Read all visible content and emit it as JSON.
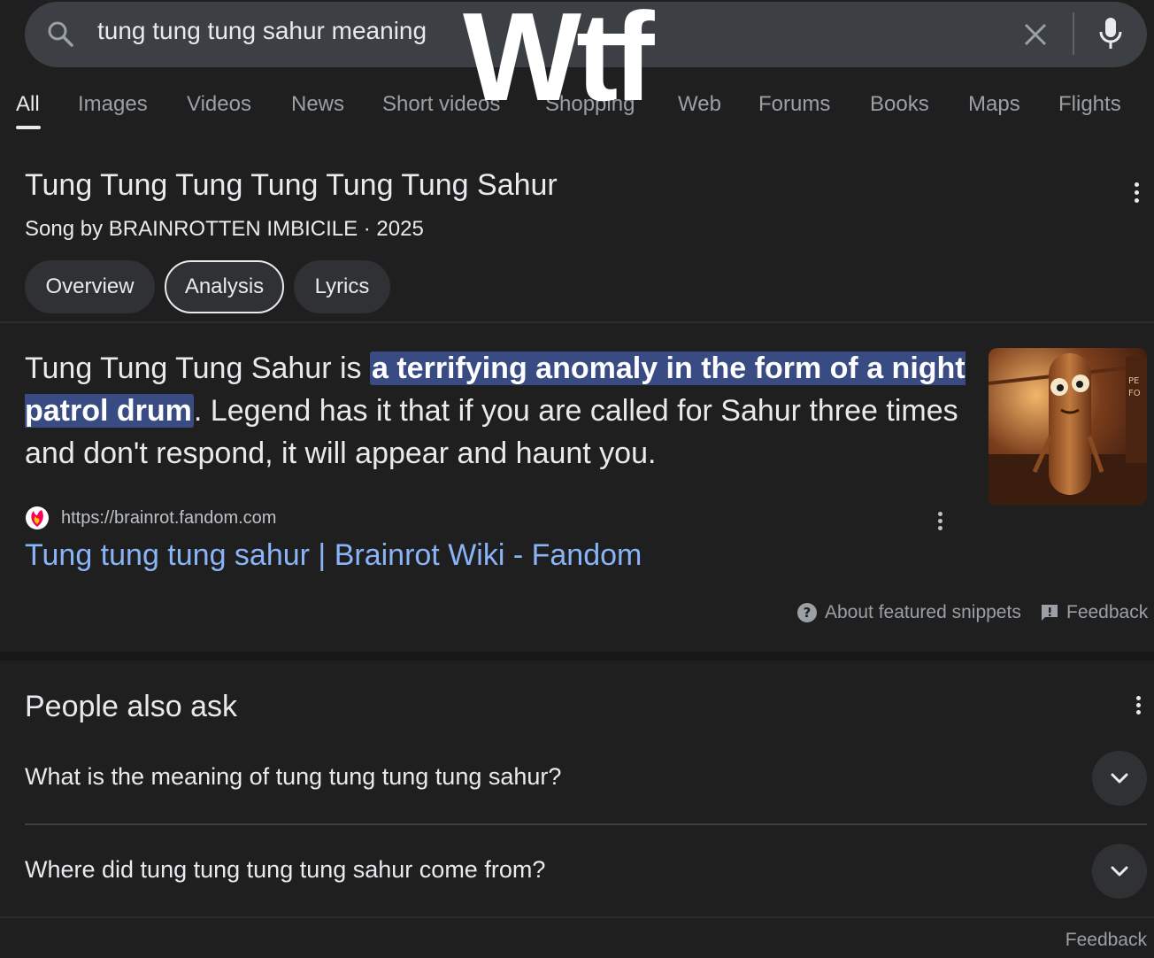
{
  "search": {
    "query": "tung tung tung sahur meaning",
    "icon": "search-icon",
    "clear_icon": "close-icon",
    "mic_icon": "microphone-icon"
  },
  "overlay": {
    "text": "Wtf"
  },
  "tabs": [
    {
      "label": "All",
      "active": true
    },
    {
      "label": "Images"
    },
    {
      "label": "Videos"
    },
    {
      "label": "News"
    },
    {
      "label": "Short videos"
    },
    {
      "label": "Shopping"
    },
    {
      "label": "Web"
    },
    {
      "label": "Forums"
    },
    {
      "label": "Books"
    },
    {
      "label": "Maps"
    },
    {
      "label": "Flights"
    }
  ],
  "knowledge_card": {
    "title": "Tung Tung Tung Tung Tung Tung Sahur",
    "subtitle": "Song by BRAINROTTEN IMBICILE · 2025",
    "chips": [
      {
        "label": "Overview"
      },
      {
        "label": "Analysis",
        "selected": true
      },
      {
        "label": "Lyrics"
      }
    ]
  },
  "snippet": {
    "prefix": "Tung Tung Tung Sahur is ",
    "highlight": "a terrifying anomaly in the form of a night patrol drum",
    "suffix": ". Legend has it that if you are called for Sahur three times and don't respond, it will appear and haunt you.",
    "source_url": "https://brainrot.fandom.com",
    "link_title": "Tung tung tung sahur | Brainrot Wiki - Fandom",
    "about_label": "About featured snippets",
    "feedback_label": "Feedback"
  },
  "paa": {
    "title": "People also ask",
    "questions": [
      "What is the meaning of tung tung tung tung sahur?",
      "Where did tung tung tung tung sahur come from?"
    ]
  },
  "footer": {
    "feedback_label": "Feedback"
  },
  "colors": {
    "background": "#1f1f1f",
    "link": "#8ab4f8",
    "highlight": "#394b83"
  }
}
